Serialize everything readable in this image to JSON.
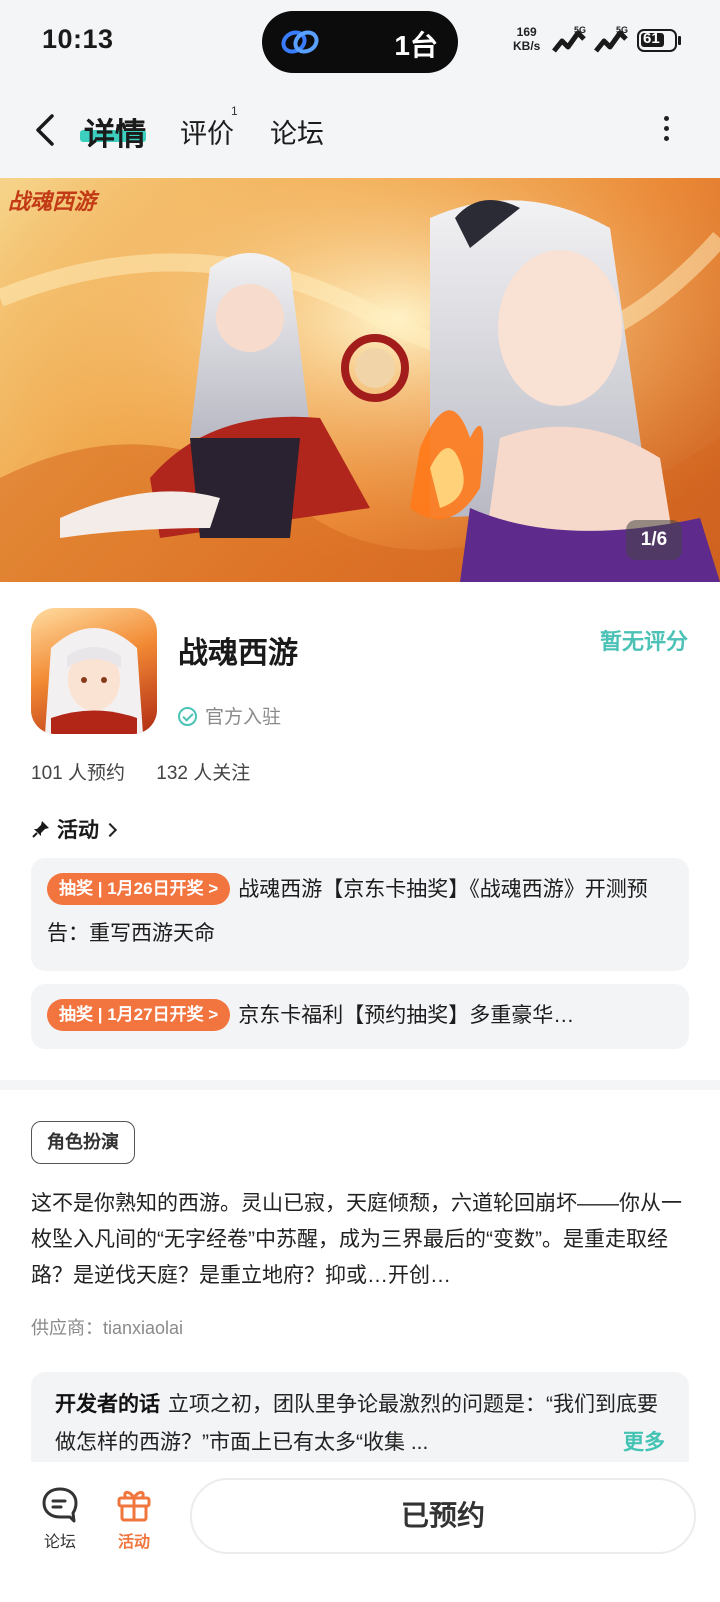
{
  "status_bar": {
    "time": "10:13",
    "island_text": "1台",
    "net_speed_value": "169",
    "net_speed_unit": "KB/s",
    "signal_label": "5G",
    "battery_level": "61"
  },
  "nav": {
    "tabs": [
      {
        "label": "详情"
      },
      {
        "label": "评价"
      },
      {
        "label": "论坛"
      }
    ],
    "reviews_count": "1"
  },
  "banner": {
    "counter": "1/6",
    "logo_text": "战魂西游"
  },
  "app": {
    "name": "战魂西游",
    "rating": "暂无评分",
    "official_label": "官方入驻",
    "reservations": "101 人预约",
    "followers": "132 人关注"
  },
  "activities": {
    "header": "活动",
    "items": [
      {
        "badge": "抽奖 | 1月26日开奖 >",
        "text": "战魂西游【京东卡抽奖】《战魂西游》开测预告：重写西游天命"
      },
      {
        "badge": "抽奖 | 1月27日开奖 >",
        "text": "京东卡福利【预约抽奖】多重豪华…"
      }
    ]
  },
  "details": {
    "genre_tag": "角色扮演",
    "description": "这不是你熟知的西游。灵山已寂，天庭倾颓，六道轮回崩坏——你从一枚坠入凡间的“无字经卷”中苏醒，成为三界最后的“变数”。是重走取经路？是逆伐天庭？是重立地府？抑或…开创…",
    "supplier": "供应商：tianxiaolai"
  },
  "developer_note": {
    "title": "开发者的话",
    "text": "立项之初，团队里争论最激烈的问题是：“我们到底要做怎样的西游？”市面上已有太多“收集 ...",
    "more": "更多"
  },
  "bottom_bar": {
    "forum_label": "论坛",
    "activity_label": "活动",
    "reserve_button": "已预约"
  },
  "colors": {
    "accent_teal": "#3ccfbf",
    "accent_orange": "#f2743f",
    "background_gray": "#f4f5f7"
  }
}
